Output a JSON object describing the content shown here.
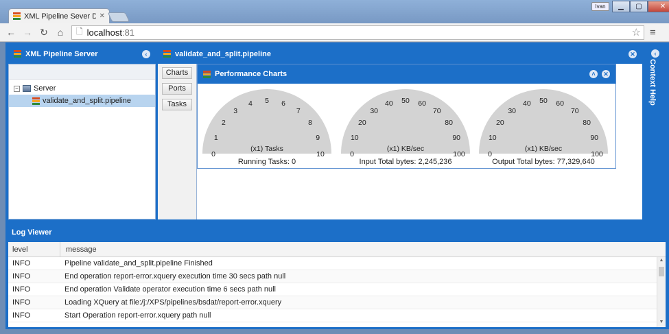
{
  "browser": {
    "tab_title": "XML Pipeline Sever Dashb",
    "tab_close": "✕",
    "user_badge": "Ivan",
    "url_host": "localhost",
    "url_port": ":81"
  },
  "left_panel": {
    "title": "XML Pipeline Server",
    "tree": [
      {
        "label": "Server"
      },
      {
        "label": "validate_and_split.pipeline"
      }
    ]
  },
  "center_panel": {
    "title": "validate_and_split.pipeline",
    "tabs": [
      "Charts",
      "Ports",
      "Tasks"
    ]
  },
  "performance": {
    "title": "Performance Charts",
    "gauges": [
      {
        "unit": "(x1) Tasks",
        "ticks": [
          "0",
          "1",
          "2",
          "3",
          "4",
          "5",
          "6",
          "7",
          "8",
          "9",
          "10"
        ],
        "caption": "Running Tasks: 0"
      },
      {
        "unit": "(x1) KB/sec",
        "ticks": [
          "0",
          "10",
          "20",
          "30",
          "40",
          "50",
          "60",
          "70",
          "80",
          "90",
          "100"
        ],
        "caption": "Input Total bytes: 2,245,236"
      },
      {
        "unit": "(x1) KB/sec",
        "ticks": [
          "0",
          "10",
          "20",
          "30",
          "40",
          "50",
          "60",
          "70",
          "80",
          "90",
          "100"
        ],
        "caption": "Output Total bytes: 77,329,640"
      }
    ]
  },
  "context_help": {
    "label": "Context Help"
  },
  "log_viewer": {
    "title": "Log Viewer",
    "columns": {
      "level": "level",
      "message": "message"
    },
    "rows": [
      {
        "level": "INFO",
        "message": "Pipeline validate_and_split.pipeline Finished"
      },
      {
        "level": "INFO",
        "message": "End operation report-error.xquery execution time 30 secs path null"
      },
      {
        "level": "INFO",
        "message": "End operation Validate operator execution time 6 secs path null"
      },
      {
        "level": "INFO",
        "message": "Loading XQuery at file:/j:/XPS/pipelines/bsdat/report-error.xquery"
      },
      {
        "level": "INFO",
        "message": "Start Operation report-error.xquery path null"
      }
    ]
  }
}
